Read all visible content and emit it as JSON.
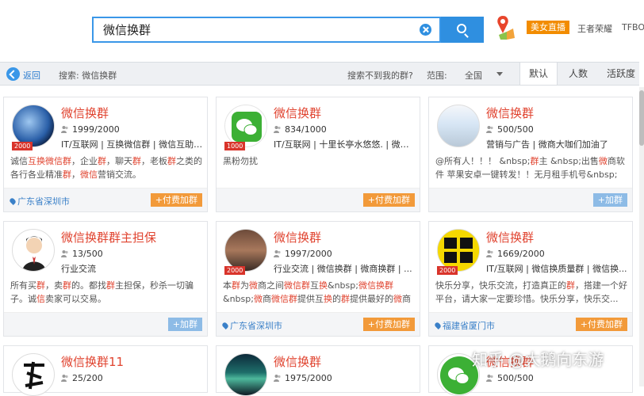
{
  "header": {
    "search_value": "微信换群",
    "live_badge": "美女直播",
    "link_1": "王者荣耀",
    "link_2": "TFBO"
  },
  "filter": {
    "back_label": "返回",
    "search_label": "搜索: 微信换群",
    "not_found": "搜索不到我的群?",
    "range_label": "范围:",
    "range_value": "全国",
    "sort_default": "默认",
    "sort_people": "人数",
    "sort_active": "活跃度"
  },
  "cards": [
    {
      "title": "微信换群",
      "members": "1999/2000",
      "tags": "IT/互联网 | 互换微信群 | 微信互助 ...",
      "desc_html": "诚信<span class='hl'>互换微信群</span>，企业<span class='hl'>群</span>，聊天<span class='hl'>群</span>，老板<span class='hl'>群</span>之类的各行各业精准<span class='hl'>群</span>，<span class='hl'>微信</span>营销交流。",
      "count": "2000",
      "location": "广东省深圳市",
      "join": "+付费加群",
      "paid": true
    },
    {
      "title": "微信换群",
      "members": "834/1000",
      "tags": "IT/互联网 | 十里长亭水悠悠. | 微信...",
      "desc_html": "黑粉勿扰",
      "count": "1000",
      "location": "",
      "join": "+付费加群",
      "paid": true
    },
    {
      "title": "微信换群",
      "members": "500/500",
      "tags": "营销与广告 | 微商大咖们加油了",
      "desc_html": "@所有人！！！ &amp;nbsp;<span class='hl'>群</span>主 &amp;nbsp;出售<span class='hl'>微</span>商软件 苹果安卓一键转发！！无月租手机号&amp;nbsp;",
      "count": "",
      "location": "",
      "join": "+加群",
      "paid": false
    },
    {
      "title": "微信换群群主担保",
      "members": "13/500",
      "tags": "行业交流",
      "desc_html": "所有买<span class='hl'>群</span>，卖<span class='hl'>群</span>的。都找<span class='hl'>群</span>主担保，秒杀一切骗子。诚<span class='hl'>信</span>卖家可以交易。",
      "count": "",
      "location": "",
      "join": "+加群",
      "paid": false
    },
    {
      "title": "微信换群",
      "members": "1997/2000",
      "tags": "行业交流 | 微信换群 | 微商换群 | ...",
      "desc_html": "本<span class='hl'>群</span>为<span class='hl'>微</span>商之间<span class='hl'>微信群</span>互<span class='hl'>换</span>&amp;nbsp;<span class='hl'>微信换群</span>&amp;nbsp;<span class='hl'>微</span>商<span class='hl'>微信群</span>提供互<span class='hl'>换</span>的<span class='hl'>群</span>提供最好的<span class='hl'>微</span>商<span class='hl'>换群</span>...",
      "count": "2000",
      "location": "广东省深圳市",
      "join": "+付费加群",
      "paid": true
    },
    {
      "title": "微信换群",
      "members": "1669/2000",
      "tags": "IT/互联网 | 微信换质量群 | 微信换...",
      "desc_html": "快乐分享，快乐交流，打造真正的<span class='hl'>群</span>，搭建一个好平台，请大家一定要珍惜。快乐分享，快乐交...",
      "count": "2000",
      "location": "福建省厦门市",
      "join": "+付费加群",
      "paid": true
    },
    {
      "title": "微信换群11",
      "members": "25/200",
      "tags": "",
      "desc_html": "",
      "count": "",
      "location": "",
      "join": "",
      "paid": false
    },
    {
      "title": "微信换群",
      "members": "1975/2000",
      "tags": "",
      "desc_html": "",
      "count": "",
      "location": "",
      "join": "",
      "paid": false
    },
    {
      "title": "微信换群",
      "members": "500/500",
      "tags": "",
      "desc_html": "",
      "count": "",
      "location": "",
      "join": "",
      "paid": false
    }
  ],
  "watermark": "知乎 @大鹅向东游"
}
